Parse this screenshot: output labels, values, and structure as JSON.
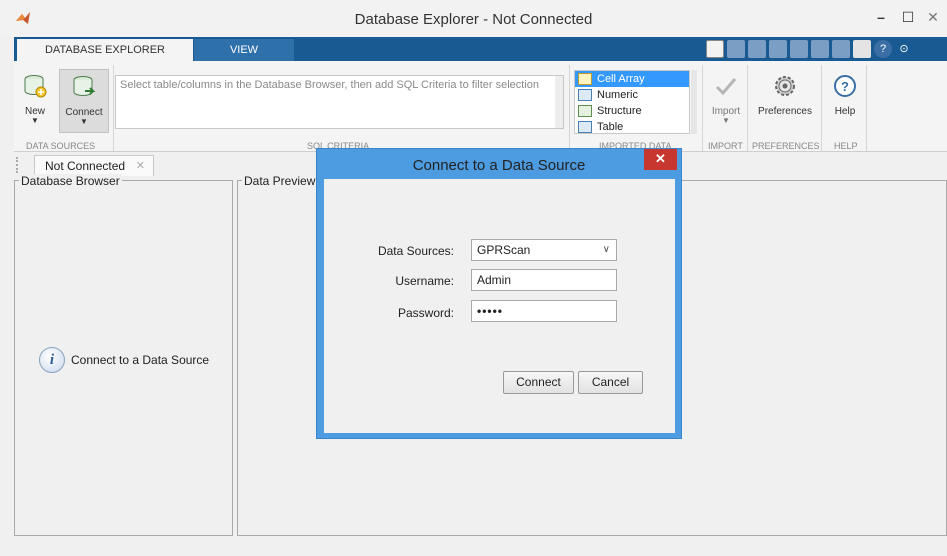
{
  "window": {
    "title": "Database Explorer - Not Connected",
    "minimize_glyph": "–",
    "maximize_glyph": "☐",
    "close_glyph": "✕"
  },
  "tabs": {
    "database_explorer": "DATABASE EXPLORER",
    "view": "VIEW"
  },
  "ribbon": {
    "new_label": "New",
    "connect_label": "Connect",
    "sql_placeholder": "Select table/columns in the Database Browser, then add SQL Criteria to filter selection",
    "imported_data_items": [
      "Cell Array",
      "Numeric",
      "Structure",
      "Table"
    ],
    "selected_import_type": "Cell Array",
    "import_label": "Import",
    "preferences_label": "Preferences",
    "help_label": "Help",
    "section_data_sources": "DATA SOURCES",
    "section_sql_criteria": "SQL CRITERIA",
    "section_imported_data": "IMPORTED DATA",
    "section_import": "IMPORT",
    "section_preferences": "PREFERENCES",
    "section_help": "HELP"
  },
  "document_tab": {
    "label": "Not Connected",
    "close_glyph": "✕"
  },
  "browser_panel": {
    "title": "Database Browser",
    "info_text": "Connect to a Data Source"
  },
  "preview_panel": {
    "title": "Data Preview"
  },
  "dialog": {
    "title": "Connect to a Data Source",
    "close_glyph": "✕",
    "data_sources_label": "Data Sources:",
    "data_sources_value": "GPRScan",
    "username_label": "Username:",
    "username_value": "Admin",
    "password_label": "Password:",
    "password_masked": "•••••",
    "connect_button": "Connect",
    "cancel_button": "Cancel"
  },
  "colors": {
    "tabstrip": "#1a5a92",
    "dialog_frame": "#4d9be0",
    "dialog_close": "#c7372f",
    "selection": "#3399ff"
  }
}
